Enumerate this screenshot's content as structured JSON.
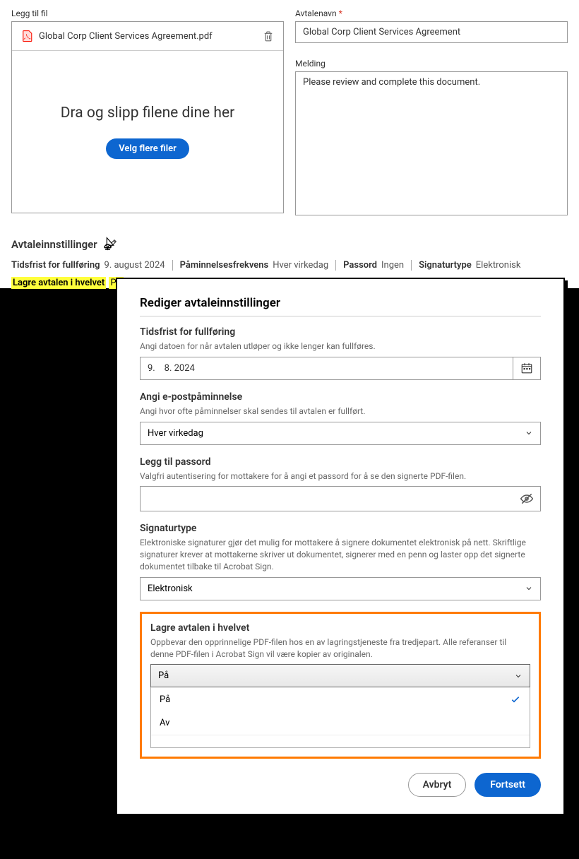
{
  "file": {
    "label": "Legg til fil",
    "name": "Global Corp Client Services Agreement.pdf",
    "dropzone": "Dra og slipp filene dine her",
    "more_button": "Velg flere filer"
  },
  "agreement": {
    "name_label": "Avtalenavn",
    "name_value": "Global Corp Client Services Agreement",
    "message_label": "Melding",
    "message_value": "Please review and complete this document."
  },
  "settings_section": {
    "title": "Avtaleinnstillinger",
    "deadline_key": "Tidsfrist for fullføring",
    "deadline_val": "9. august 2024",
    "reminder_key": "Påminnelsesfrekvens",
    "reminder_val": "Hver virkedag",
    "password_key": "Passord",
    "password_val": "Ingen",
    "sigtype_key": "Signaturtype",
    "sigtype_val": "Elektronisk",
    "vault_key": "Lagre avtalen i hvelvet",
    "vault_val": "På"
  },
  "modal": {
    "title": "Rediger avtaleinnstillinger",
    "deadline": {
      "label": "Tidsfrist for fullføring",
      "help": "Angi datoen for når avtalen utløper og ikke lenger kan fullføres.",
      "value": "9.    8. 2024"
    },
    "reminder": {
      "label": "Angi e-postpåminnelse",
      "help": "Angi hvor ofte påminnelser skal sendes til avtalen er fullført.",
      "value": "Hver virkedag"
    },
    "password": {
      "label": "Legg til passord",
      "help": "Valgfri autentisering for mottakere for å angi et passord for å se den signerte PDF-filen."
    },
    "sigtype": {
      "label": "Signaturtype",
      "help": "Elektroniske signaturer gjør det mulig for mottakere å signere dokumentet elektronisk på nett. Skriftlige signaturer krever at mottakerne skriver ut dokumentet, signerer med en penn og laster opp det signerte dokumentet tilbake til Acrobat Sign.",
      "value": "Elektronisk"
    },
    "vault": {
      "label": "Lagre avtalen i hvelvet",
      "help": "Oppbevar den opprinnelige PDF-filen hos en av lagringstjeneste fra tredjepart. Alle referanser til denne PDF-filen i Acrobat Sign vil være kopier av originalen.",
      "value": "På",
      "options": {
        "on": "På",
        "off": "Av"
      }
    },
    "buttons": {
      "cancel": "Avbryt",
      "continue": "Fortsett"
    }
  }
}
